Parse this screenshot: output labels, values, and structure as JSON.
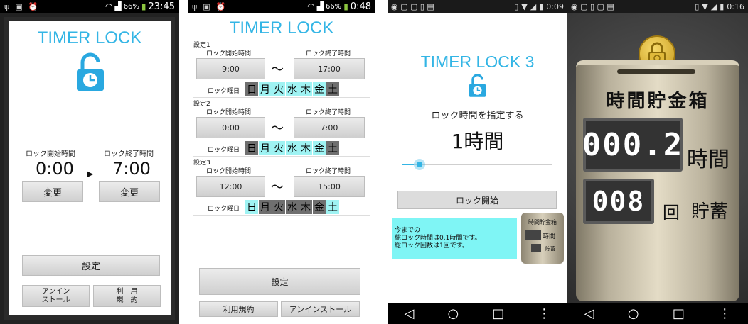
{
  "panel1": {
    "status": {
      "icons": [
        "usb-icon",
        "image-icon",
        "alarm-icon"
      ],
      "battery": "66%",
      "time": "23:45"
    },
    "title": "TIMER LOCK",
    "start_label": "ロック開始時間",
    "end_label": "ロック終了時間",
    "start_time": "0:00",
    "end_time": "7:00",
    "change_label": "変更",
    "settings_label": "設定",
    "uninstall_label": "アンイン\nストール",
    "terms_label": "利　用\n規　約"
  },
  "panel2": {
    "status": {
      "battery": "66%",
      "time": "0:48"
    },
    "title": "TIMER LOCK",
    "start_label": "ロック開始時間",
    "end_label": "ロック終了時間",
    "tilde": "〜",
    "days_label": "ロック曜日",
    "days": [
      "日",
      "月",
      "火",
      "水",
      "木",
      "金",
      "土"
    ],
    "settings": [
      {
        "name": "設定1",
        "start": "9:00",
        "end": "17:00",
        "active": [
          false,
          true,
          true,
          true,
          true,
          true,
          false
        ]
      },
      {
        "name": "設定2",
        "start": "0:00",
        "end": "7:00",
        "active": [
          false,
          true,
          true,
          true,
          true,
          true,
          false
        ]
      },
      {
        "name": "設定3",
        "start": "12:00",
        "end": "15:00",
        "active": [
          true,
          false,
          false,
          false,
          false,
          false,
          true
        ]
      }
    ],
    "settings_label": "設定",
    "terms_label": "利用規約",
    "uninstall_label": "アンインストール"
  },
  "panel3": {
    "status": {
      "time": "0:09"
    },
    "title": "TIMER LOCK 3",
    "prompt": "ロック時間を指定する",
    "duration": "1時間",
    "slider_value": 0.08,
    "start_label": "ロック開始",
    "info_line1": "今までの",
    "info_line2": "総ロック時間は0.1時間です。",
    "info_line3": "総ロック回数は1回です。",
    "mini_title": "時間貯金箱",
    "mini_hours_unit": "時間",
    "mini_count_unit": "貯蓄"
  },
  "panel4": {
    "status": {
      "time": "0:16"
    },
    "bank_title": "時間貯金箱",
    "hours_value": "000.2",
    "hours_unit": "時間",
    "count_value": "008",
    "count_unit1": "回",
    "count_unit2": "貯蓄"
  },
  "nav": {
    "back": "◁",
    "home": "○",
    "recent": "□",
    "menu": "⋮"
  },
  "colors": {
    "accent": "#33b5e5",
    "day_on": "#9ff3f3",
    "day_off": "#6f6f6f",
    "info_bg": "#7ff5f5"
  }
}
